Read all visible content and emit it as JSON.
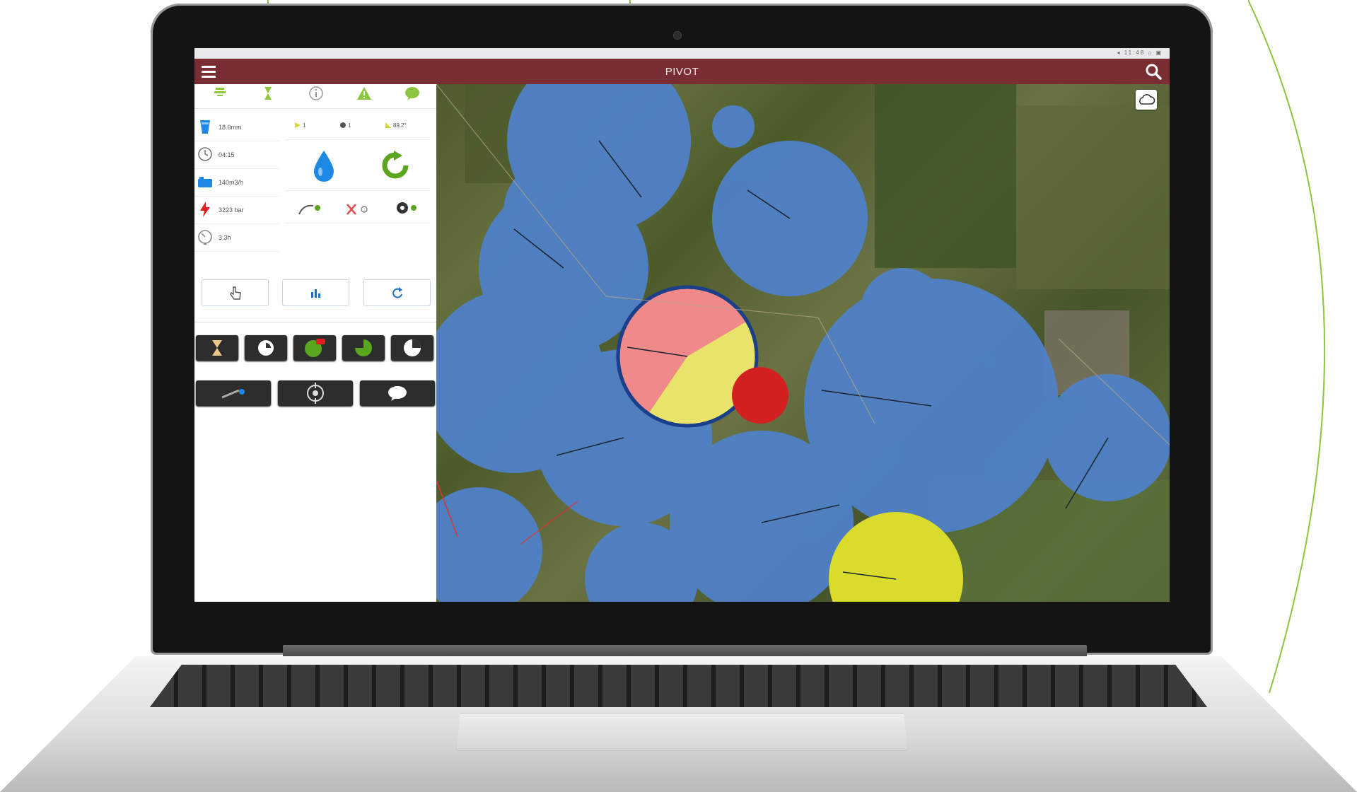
{
  "app": {
    "title": "PIVOT"
  },
  "statusbar": {
    "icons_text": "◂ 11:48  ⌂  ▣"
  },
  "top_tabs": [
    {
      "name": "summary",
      "label": ""
    },
    {
      "name": "timer",
      "label": ""
    },
    {
      "name": "info",
      "label": ""
    },
    {
      "name": "alerts",
      "label": ""
    },
    {
      "name": "sms",
      "label": ""
    }
  ],
  "stats": [
    {
      "icon": "water-depth-icon",
      "value": "18.0mm"
    },
    {
      "icon": "clock-icon",
      "value": "04:15"
    },
    {
      "icon": "flow-icon",
      "value": "140m3/h"
    },
    {
      "icon": "power-icon",
      "value": "3223 bar"
    },
    {
      "icon": "speed-gauge-icon",
      "value": "3.3h"
    }
  ],
  "mini_stats": [
    {
      "icon": "arrow-icon",
      "value": "1"
    },
    {
      "icon": "pump-icon",
      "value": "1"
    },
    {
      "icon": "angle-icon",
      "value": "89.2°"
    }
  ],
  "colors": {
    "appbar": "#7a2e34",
    "accent_green": "#8cc63f",
    "water_blue": "#1e88e5",
    "pivot_blue": "#4f81c7",
    "pivot_pink": "#f08a8a",
    "pivot_yellow": "#e8e36a",
    "pivot_red": "#d32020",
    "pivot_lime": "#d9dc2c"
  },
  "action_buttons": [
    "manual-control",
    "chart",
    "refresh"
  ],
  "dark_buttons": [
    "hourglass",
    "timer-start",
    "program-new",
    "sector-program",
    "sector-pie",
    "pivot-status",
    "gps-target",
    "sms"
  ]
}
